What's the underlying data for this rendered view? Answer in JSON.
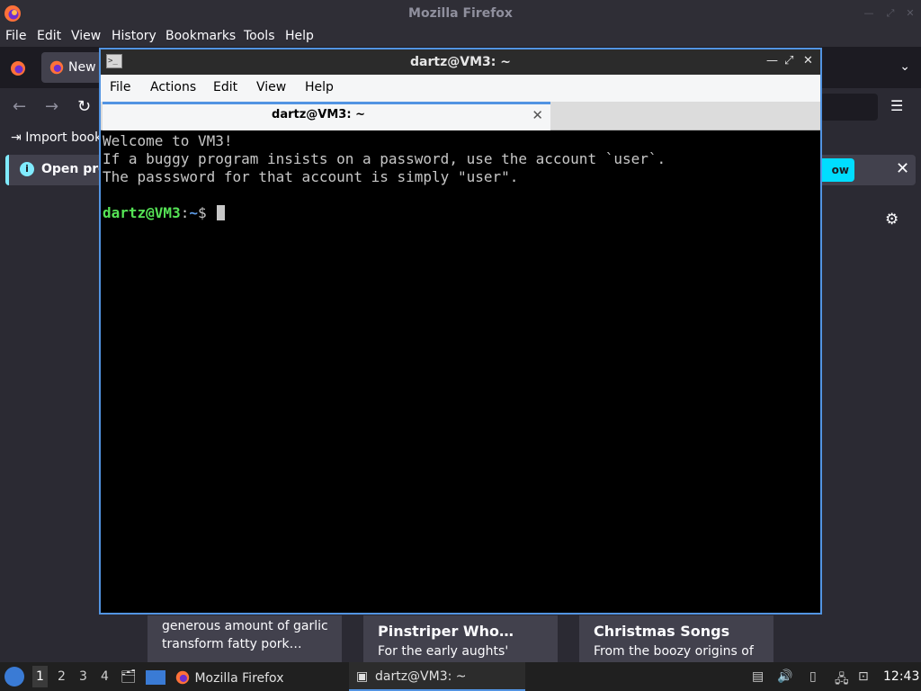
{
  "firefox": {
    "window_title": "Mozilla Firefox",
    "menu": [
      "File",
      "Edit",
      "View",
      "History",
      "Bookmarks",
      "Tools",
      "Help"
    ],
    "tab_label": "New",
    "bookmarks_import": "Import book",
    "notification_text": "Open pre",
    "notification_button": "ow",
    "stories": [
      {
        "title": "",
        "desc_line1": "generous amount of garlic",
        "desc_line2": "transform fatty pork…"
      },
      {
        "title": "Pinstriper Who…",
        "desc_line1": "For the early aughts'",
        "desc_line2": ""
      },
      {
        "title": "Christmas Songs",
        "desc_line1": "From the boozy origins of",
        "desc_line2": ""
      }
    ]
  },
  "terminal": {
    "window_title": "dartz@VM3: ~",
    "menu": [
      "File",
      "Actions",
      "Edit",
      "View",
      "Help"
    ],
    "tab_label": "dartz@VM3: ~",
    "lines": [
      "Welcome to VM3!",
      "If a buggy program insists on a password, use the account `user`.",
      "The passsword for that account is simply \"user\".",
      ""
    ],
    "prompt_user": "dartz@VM3",
    "prompt_sep": ":",
    "prompt_path": "~",
    "prompt_symbol": "$ "
  },
  "taskbar": {
    "workspaces": [
      "1",
      "2",
      "3",
      "4"
    ],
    "tasks": [
      "Mozilla Firefox",
      "dartz@VM3: ~"
    ],
    "clock": "12:43"
  },
  "colors": {
    "accent": "#5294e2",
    "prompt_user": "#55e355",
    "prompt_path": "#5e9de8",
    "firefox_bg": "#2b2a33"
  }
}
